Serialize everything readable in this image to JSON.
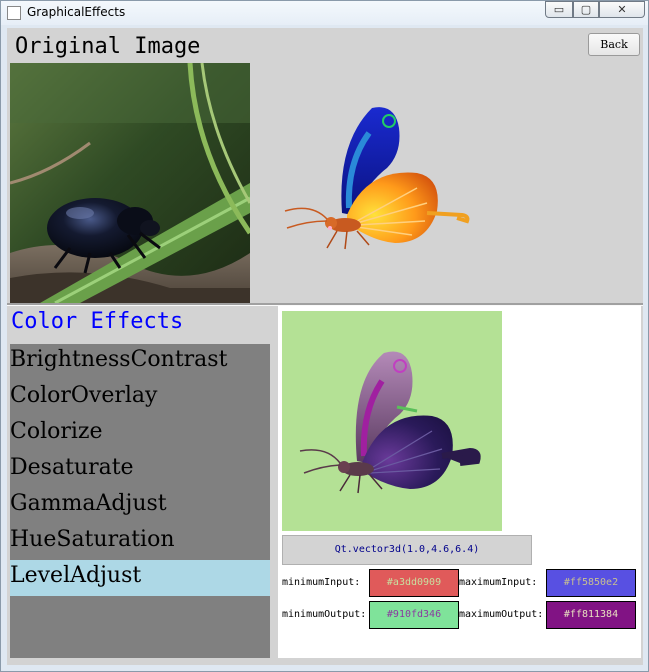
{
  "window": {
    "title": "GraphicalEffects",
    "controls": {
      "minimize": "▭",
      "maximize": "▢",
      "close": "✕"
    }
  },
  "header": {
    "title": "Original Image",
    "back_label": "Back"
  },
  "effects": {
    "title": "Color Effects",
    "items": [
      {
        "label": "BrightnessContrast",
        "selected": false
      },
      {
        "label": "ColorOverlay",
        "selected": false
      },
      {
        "label": "Colorize",
        "selected": false
      },
      {
        "label": "Desaturate",
        "selected": false
      },
      {
        "label": "GammaAdjust",
        "selected": false
      },
      {
        "label": "HueSaturation",
        "selected": false
      },
      {
        "label": "LevelAdjust",
        "selected": true
      }
    ]
  },
  "parameters": {
    "gamma": "Qt.vector3d(1.0,4.6,6.4)",
    "minimum_input": {
      "label": "minimumInput:",
      "value": "#a3dd0909",
      "bg": "#e05a5a",
      "fg": "#c8dfa0"
    },
    "maximum_input": {
      "label": "maximumInput:",
      "value": "#ff5850e2",
      "bg": "#5850e2",
      "fg": "#c8c090"
    },
    "minimum_output": {
      "label": "minimumOutput:",
      "value": "#910fd346",
      "bg": "#7fe39a",
      "fg": "#8a3aa0"
    },
    "maximum_output": {
      "label": "maximumOutput:",
      "value": "#ff811384",
      "bg": "#811384",
      "fg": "#e8e0c0"
    }
  },
  "colors": {
    "effects_title": "#0000ff",
    "selected_item": "#add8e6",
    "list_bg": "#808080",
    "preview_bg": "#b4e195"
  }
}
